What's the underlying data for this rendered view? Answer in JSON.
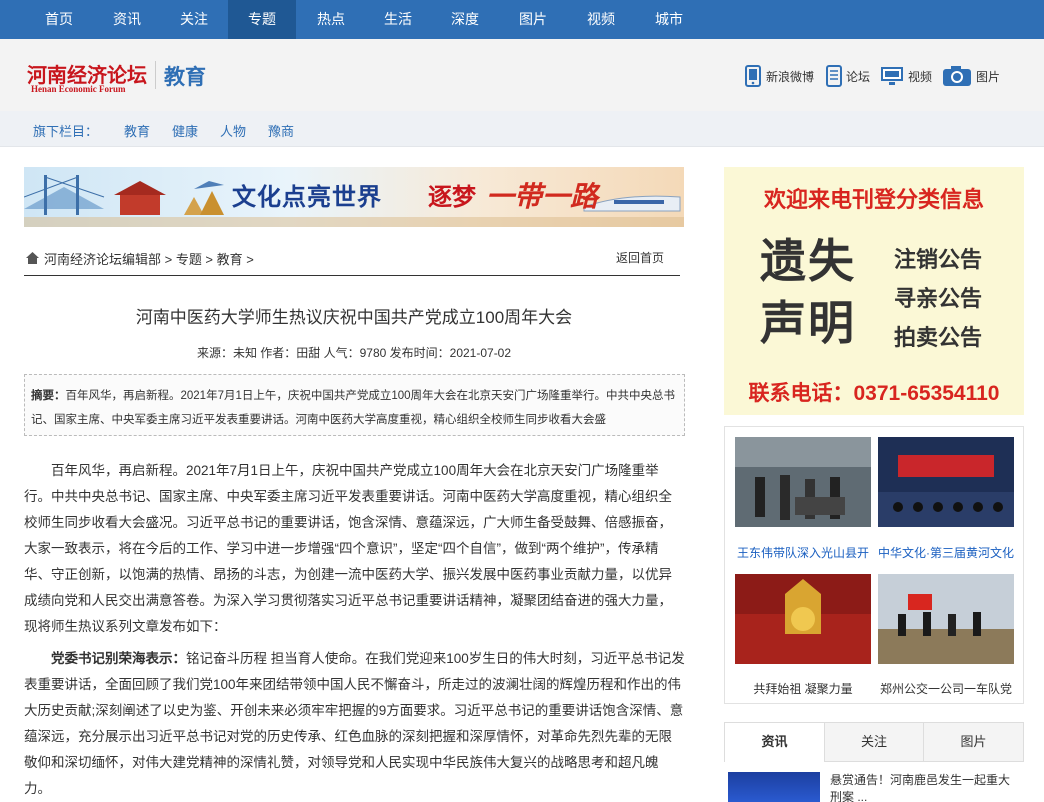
{
  "nav": {
    "items": [
      "首页",
      "资讯",
      "关注",
      "专题",
      "热点",
      "生活",
      "深度",
      "图片",
      "视频",
      "城市"
    ],
    "active_index": 3
  },
  "header": {
    "logo_cn": "河南经济论坛",
    "logo_en": "Henan Economic Forum",
    "channel": "教育",
    "links": [
      {
        "label": "新浪微博",
        "icon": "phone-icon"
      },
      {
        "label": "论坛",
        "icon": "tablet-icon"
      },
      {
        "label": "视频",
        "icon": "monitor-icon"
      },
      {
        "label": "图片",
        "icon": "camera-icon"
      }
    ]
  },
  "subbar": {
    "label": "旗下栏目：",
    "items": [
      "教育",
      "健康",
      "人物",
      "豫商"
    ]
  },
  "banner": {
    "text1": "文化点亮世界",
    "text2": "逐梦",
    "text3": "一带一路"
  },
  "breadcrumb": {
    "path": "河南经济论坛编辑部 > 专题 > 教育 >",
    "back": "返回首页"
  },
  "article": {
    "title": "河南中医药大学师生热议庆祝中国共产党成立100周年大会",
    "meta": "来源：未知 作者：田甜 人气：9780 发布时间：2021-07-02",
    "abstract_label": "摘要：",
    "abstract": "百年风华，再启新程。2021年7月1日上午，庆祝中国共产党成立100周年大会在北京天安门广场隆重举行。中共中央总书记、国家主席、中央军委主席习近平发表重要讲话。河南中医药大学高度重视，精心组织全校师生同步收看大会盛",
    "p1": "百年风华，再启新程。2021年7月1日上午，庆祝中国共产党成立100周年大会在北京天安门广场隆重举行。中共中央总书记、国家主席、中央军委主席习近平发表重要讲话。河南中医药大学高度重视，精心组织全校师生同步收看大会盛况。习近平总书记的重要讲话，饱含深情、意蕴深远，广大师生备受鼓舞、倍感振奋，大家一致表示，将在今后的工作、学习中进一步增强“四个意识”，坚定“四个自信”，做到“两个维护”，传承精华、守正创新，以饱满的热情、昂扬的斗志，为创建一流中医药大学、振兴发展中医药事业贡献力量，以优异成绩向党和人民交出满意答卷。为深入学习贯彻落实习近平总书记重要讲话精神，凝聚团结奋进的强大力量，现将师生热议系列文章发布如下：",
    "p2_bold": "党委书记别荣海表示：",
    "p2": "铭记奋斗历程 担当育人使命。在我们党迎来100岁生日的伟大时刻，习近平总书记发表重要讲话，全面回顾了我们党100年来团结带领中国人民不懈奋斗，所走过的波澜壮阔的辉煌历程和作出的伟大历史贡献;深刻阐述了以史为鉴、开创未来必须牢牢把握的9方面要求。习近平总书记的重要讲话饱含深情、意蕴深远，充分展示出习近平总书记对党的历史传承、红色血脉的深刻把握和深厚情怀，对革命先烈先辈的无限敬仰和深切缅怀，对伟大建党精神的深情礼赞，对领导党和人民实现中华民族伟大复兴的战略思考和超凡魄力。"
  },
  "ad": {
    "top": "欢迎来电刊登分类信息",
    "big1": "遗失",
    "big2": "声明",
    "r1": "注销公告",
    "r2": "寻亲公告",
    "r3": "拍卖公告",
    "phone": "联系电话：0371-65354110"
  },
  "photos": [
    {
      "caption": "王东伟带队深入光山县开",
      "color": "#1a5fc0"
    },
    {
      "caption": "中华文化·第三届黄河文化",
      "color": "#1a5fc0"
    },
    {
      "caption": "共拜始祖 凝聚力量",
      "color": "#333333"
    },
    {
      "caption": "郑州公交一公司一车队党",
      "color": "#333333"
    }
  ],
  "tabs": [
    "资讯",
    "关注",
    "图片"
  ],
  "news": {
    "line1": "悬赏通告！河南鹿邑发生一起重大",
    "line2": "刑案 ..."
  }
}
